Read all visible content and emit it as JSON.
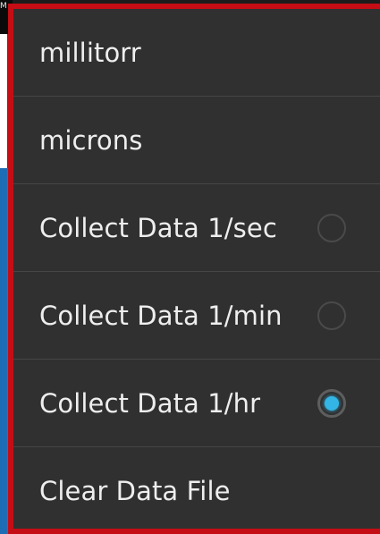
{
  "background_screen": {
    "corner_label": "M"
  },
  "menu": {
    "items": [
      {
        "label": "millitorr",
        "has_radio": false
      },
      {
        "label": "microns",
        "has_radio": false
      },
      {
        "label": "Collect Data 1/sec",
        "has_radio": true,
        "checked": false
      },
      {
        "label": "Collect Data 1/min",
        "has_radio": true,
        "checked": false
      },
      {
        "label": "Collect Data 1/hr",
        "has_radio": true,
        "checked": true
      },
      {
        "label": "Clear Data File",
        "has_radio": false
      }
    ]
  },
  "colors": {
    "menu_background": "#303030",
    "highlight_border": "#c40d14",
    "radio_accent": "#33b5e5",
    "text": "#eeeeee",
    "divider": "#464646"
  }
}
